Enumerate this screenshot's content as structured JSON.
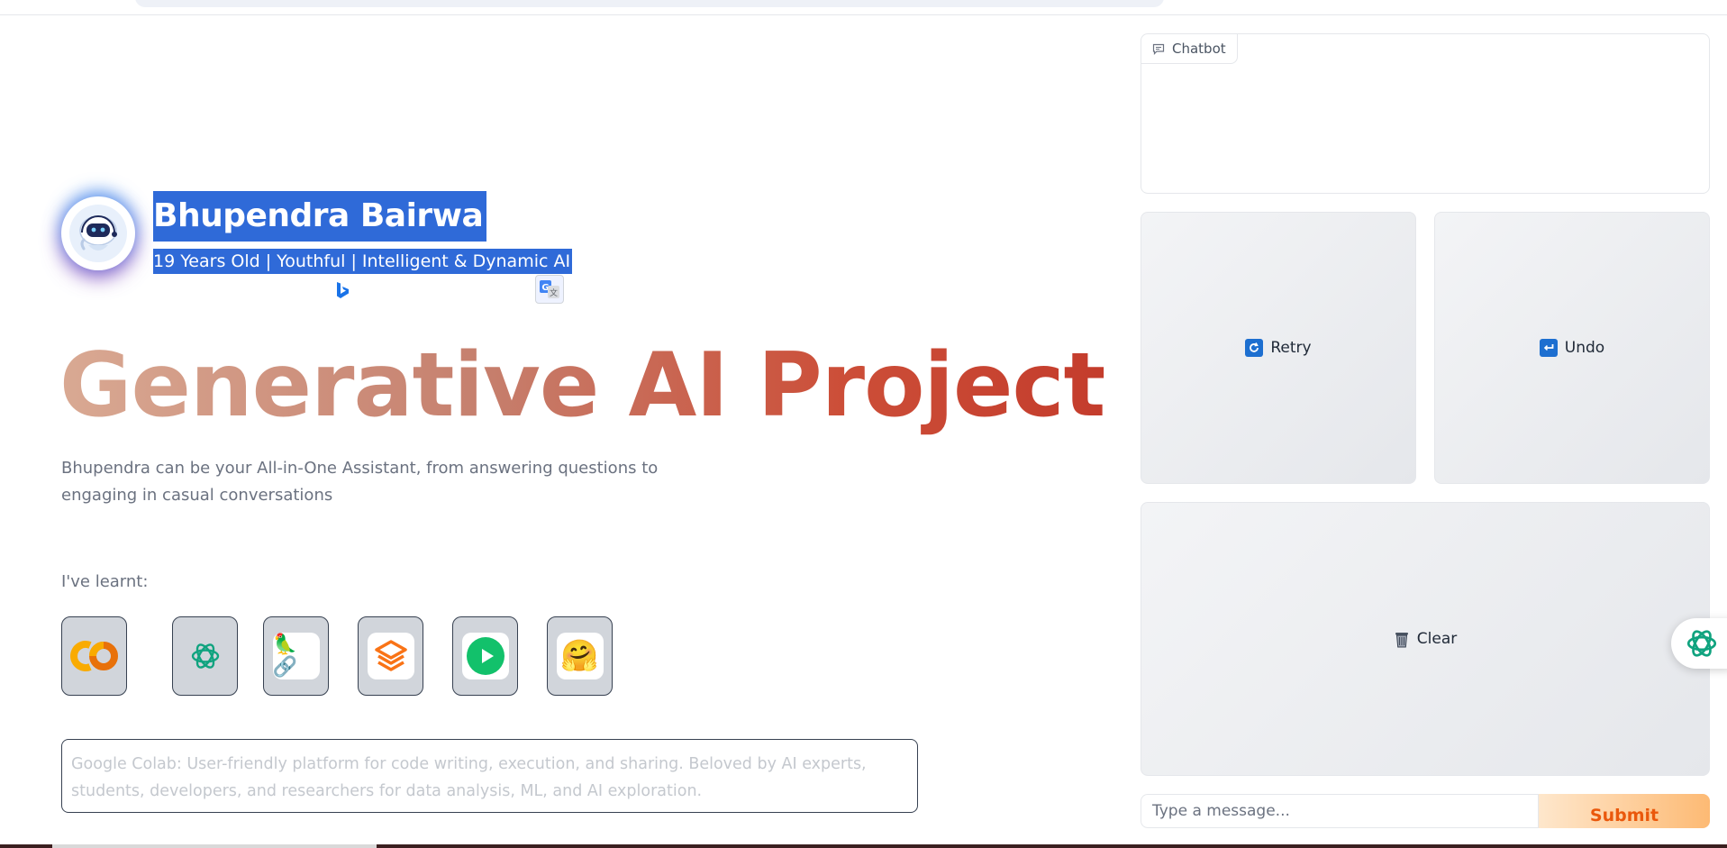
{
  "profile": {
    "name": "Bhupendra Bairwa",
    "tagline": "19 Years Old | Youthful | Intelligent & Dynamic AI",
    "avatar_icon": "robot-icon"
  },
  "hero": {
    "title": "Generative AI Project",
    "title_gradient": [
      "#d9a993",
      "#c6806e",
      "#cc4e38",
      "#c43c2c"
    ],
    "description": "Bhupendra can be your All-in-One Assistant, from answering questions to engaging in casual conversations"
  },
  "learnt": {
    "label": "I've learnt:",
    "tools": [
      {
        "icon": "google-colab-icon"
      },
      {
        "icon": "openai-icon"
      },
      {
        "icon": "langchain-parrot-icon",
        "glyph": "🦜🔗"
      },
      {
        "icon": "stack-layers-icon"
      },
      {
        "icon": "play-circle-icon"
      },
      {
        "icon": "hugging-face-icon",
        "glyph": "🤗"
      }
    ]
  },
  "info_box": {
    "text": "Google Colab: User-friendly platform for code writing, execution, and sharing. Beloved by AI experts, students, developers, and researchers for data analysis, ML, and AI exploration."
  },
  "chat": {
    "chatbot_label": "Chatbot",
    "retry": {
      "glyph": "🔄",
      "label": "Retry"
    },
    "undo": {
      "glyph": "↩️",
      "label": "Undo"
    },
    "clear": {
      "glyph": "🗑️",
      "label": "Clear"
    },
    "input_placeholder": "Type a message...",
    "submit_label": "Submit"
  },
  "colors": {
    "selection": "#2f6ad8",
    "submit_text": "#ea580c",
    "border_dark": "#374151",
    "muted_text": "#6b7280"
  }
}
